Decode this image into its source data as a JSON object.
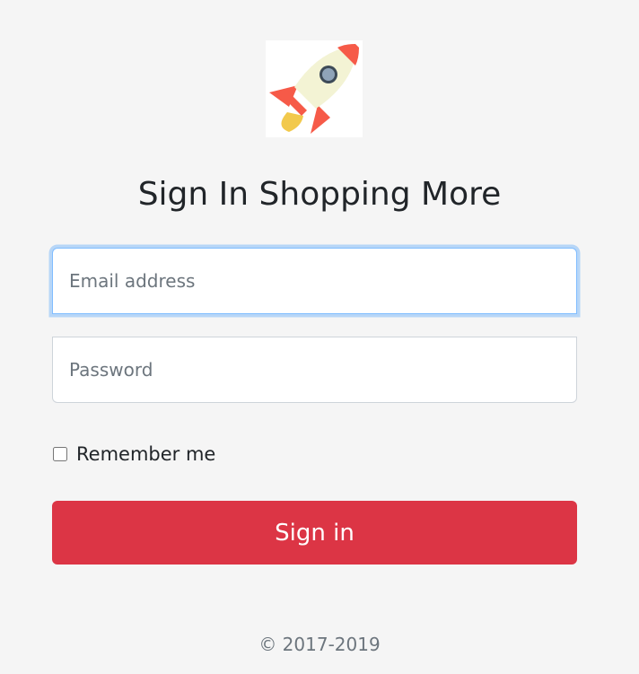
{
  "logo": {
    "icon": "rocket-icon"
  },
  "heading": "Sign In Shopping More",
  "email": {
    "placeholder": "Email address",
    "value": ""
  },
  "password": {
    "placeholder": "Password",
    "value": ""
  },
  "remember": {
    "label": "Remember me",
    "checked": false
  },
  "signin": {
    "label": "Sign in"
  },
  "footer": {
    "copyright": "© 2017-2019"
  },
  "colors": {
    "background": "#f5f5f5",
    "primary_button": "#dc3545",
    "focus_border": "#80bdff"
  }
}
